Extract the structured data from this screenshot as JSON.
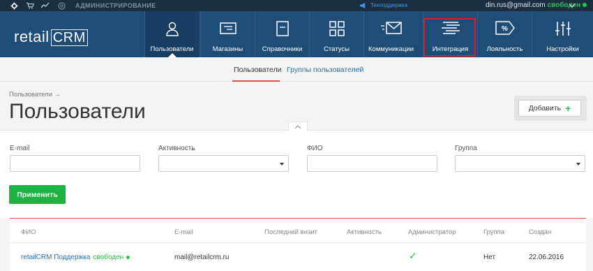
{
  "topbar": {
    "admin_label": "АДМИНИСТРИРОВАНИЕ",
    "support_label": "Техподдержка",
    "user_email": "din.rus@gmail.com",
    "user_status": "свободен"
  },
  "nav": {
    "logo_text": "retail",
    "logo_crm": "CRM",
    "items": [
      {
        "label": "Пользователи",
        "icon": "user-icon"
      },
      {
        "label": "Магазины",
        "icon": "shop-icon"
      },
      {
        "label": "Справочники",
        "icon": "book-icon"
      },
      {
        "label": "Статусы",
        "icon": "status-icon"
      },
      {
        "label": "Коммуникации",
        "icon": "envelope-icon"
      },
      {
        "label": "Интеграция",
        "icon": "integration-icon"
      },
      {
        "label": "Лояльность",
        "icon": "percent-icon"
      },
      {
        "label": "Настройки",
        "icon": "sliders-icon"
      }
    ]
  },
  "subtabs": {
    "users": "Пользователи",
    "groups": "Группы пользователей"
  },
  "page": {
    "breadcrumb": "Пользователи →",
    "title": "Пользователи",
    "add_button": "Добавить"
  },
  "filter": {
    "email_label": "E-mail",
    "activity_label": "Активность",
    "fio_label": "ФИО",
    "group_label": "Группа",
    "apply_button": "Применить"
  },
  "table": {
    "columns": [
      "ФИО",
      "E-mail",
      "Последний визит",
      "Активность",
      "Администратор",
      "Группа",
      "Создан"
    ],
    "rows": [
      {
        "fio": "retailCRM Поддержка",
        "status": "свободен",
        "email": "mail@retailcrm.ru",
        "last_visit": "",
        "activity": "",
        "admin": true,
        "group": "Нет",
        "created": "22.06.2016"
      }
    ]
  },
  "colors": {
    "nav_bg": "#1e4d78",
    "accent_green": "#1fb141",
    "highlight_red": "#e01b24"
  }
}
